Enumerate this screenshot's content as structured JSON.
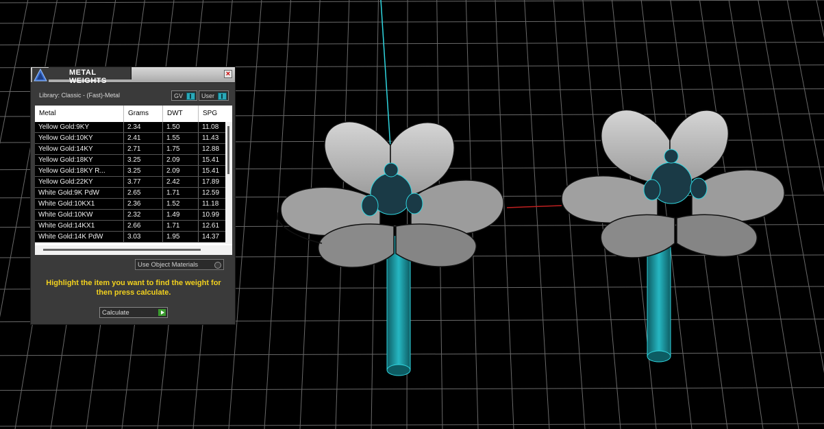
{
  "panel": {
    "title": "METAL WEIGHTS",
    "close_label": "×",
    "library": "Library: Classic - (Fast)-Metal",
    "gv_label": "GV",
    "user_label": "User",
    "columns": [
      "Metal",
      "Grams",
      "DWT",
      "SPG"
    ],
    "rows": [
      {
        "metal": "Yellow Gold:9KY",
        "grams": "2.34",
        "dwt": "1.50",
        "spg": "11.08"
      },
      {
        "metal": "Yellow Gold:10KY",
        "grams": "2.41",
        "dwt": "1.55",
        "spg": "11.43"
      },
      {
        "metal": "Yellow Gold:14KY",
        "grams": "2.71",
        "dwt": "1.75",
        "spg": "12.88"
      },
      {
        "metal": "Yellow Gold:18KY",
        "grams": "3.25",
        "dwt": "2.09",
        "spg": "15.41"
      },
      {
        "metal": "Yellow Gold:18KY R...",
        "grams": "3.25",
        "dwt": "2.09",
        "spg": "15.41"
      },
      {
        "metal": "Yellow Gold:22KY",
        "grams": "3.77",
        "dwt": "2.42",
        "spg": "17.89"
      },
      {
        "metal": "White Gold:9K PdW",
        "grams": "2.65",
        "dwt": "1.71",
        "spg": "12.59"
      },
      {
        "metal": "White Gold:10KX1",
        "grams": "2.36",
        "dwt": "1.52",
        "spg": "11.18"
      },
      {
        "metal": "White Gold:10KW",
        "grams": "2.32",
        "dwt": "1.49",
        "spg": "10.99"
      },
      {
        "metal": "White Gold:14KX1",
        "grams": "2.66",
        "dwt": "1.71",
        "spg": "12.61"
      },
      {
        "metal": "White Gold:14K PdW",
        "grams": "3.03",
        "dwt": "1.95",
        "spg": "14.37"
      }
    ],
    "use_object_materials": "Use Object Materials",
    "instructions": "Highlight the item you want to find the weight for then press calculate.",
    "calculate_label": "Calculate"
  },
  "colors": {
    "viewport_bg": "#000000",
    "grid": "#6a6a6a",
    "accent_cyan": "#2fd6e0",
    "instruction_yellow": "#f2d11e"
  }
}
